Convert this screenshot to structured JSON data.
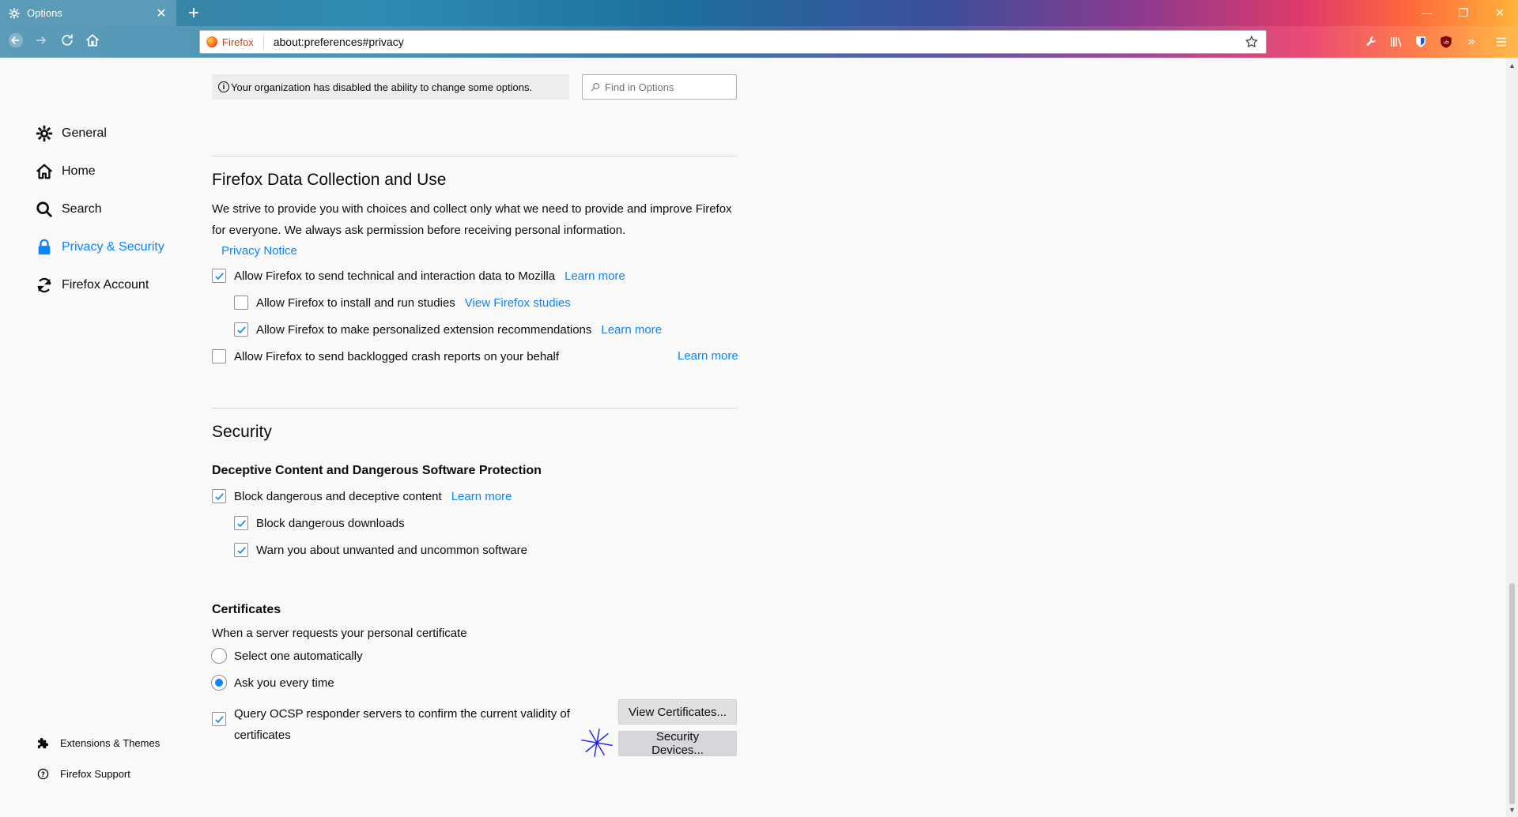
{
  "browser": {
    "tab_title": "Options",
    "new_tab": "+",
    "identity_label": "Firefox",
    "url": "about:preferences#privacy",
    "window_controls": [
      "minimize-icon",
      "restore-icon",
      "close-icon"
    ]
  },
  "notice": {
    "text": "Your organization has disabled the ability to change some options."
  },
  "search": {
    "placeholder": "Find in Options"
  },
  "sidebar": {
    "categories": [
      {
        "label": "General",
        "icon": "gear-icon"
      },
      {
        "label": "Home",
        "icon": "home-icon"
      },
      {
        "label": "Search",
        "icon": "search-icon"
      },
      {
        "label": "Privacy & Security",
        "icon": "lock-icon",
        "selected": true
      },
      {
        "label": "Firefox Account",
        "icon": "sync-icon"
      }
    ],
    "footer": [
      {
        "label": "Extensions & Themes",
        "icon": "puzzle-icon"
      },
      {
        "label": "Firefox Support",
        "icon": "help-icon"
      }
    ]
  },
  "data_collection": {
    "title": "Firefox Data Collection and Use",
    "description": "We strive to provide you with choices and collect only what we need to provide and improve Firefox for everyone. We always ask permission before receiving personal information.",
    "privacy_notice": "Privacy Notice",
    "options": [
      {
        "label": "Allow Firefox to send technical and interaction data to Mozilla",
        "checked": true,
        "link": "Learn more"
      },
      {
        "label": "Allow Firefox to install and run studies",
        "checked": false,
        "link": "View Firefox studies"
      },
      {
        "label": "Allow Firefox to make personalized extension recommendations",
        "checked": true,
        "link": "Learn more"
      },
      {
        "label": "Allow Firefox to send backlogged crash reports on your behalf",
        "checked": false,
        "link": "Learn more"
      }
    ]
  },
  "security": {
    "title": "Security",
    "deceptive_title": "Deceptive Content and Dangerous Software Protection",
    "options": [
      {
        "label": "Block dangerous and deceptive content",
        "checked": true,
        "link": "Learn more"
      },
      {
        "label": "Block dangerous downloads",
        "checked": true
      },
      {
        "label": "Warn you about unwanted and uncommon software",
        "checked": true
      }
    ]
  },
  "certificates": {
    "title": "Certificates",
    "description": "When a server requests your personal certificate",
    "radio_options": [
      {
        "label": "Select one automatically",
        "selected": false
      },
      {
        "label": "Ask you every time",
        "selected": true
      }
    ],
    "ocsp_line1": "Query OCSP responder servers to confirm the current validity of",
    "ocsp_line2": "certificates",
    "ocsp_checked": true,
    "view_certificates": "View Certificates...",
    "security_devices": "Security Devices..."
  },
  "colors": {
    "accent": "#0a84ff",
    "page_bg": "#f9f9fa"
  }
}
